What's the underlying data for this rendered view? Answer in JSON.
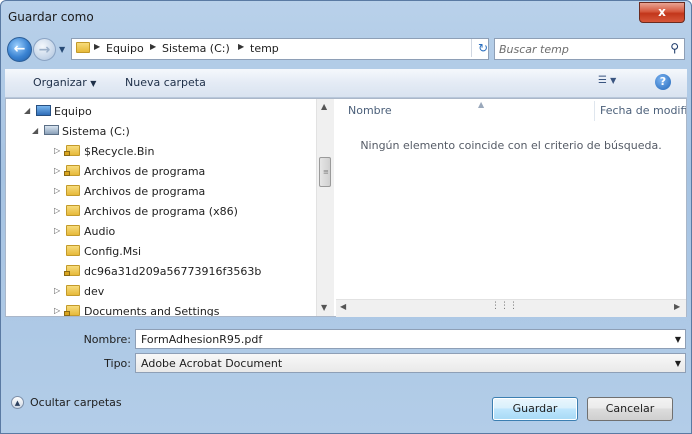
{
  "window": {
    "title": "Guardar como",
    "close_label": "x"
  },
  "address": {
    "crumbs": [
      "Equipo",
      "Sistema (C:)",
      "temp"
    ]
  },
  "search": {
    "placeholder": "Buscar temp"
  },
  "toolbar": {
    "organize_label": "Organizar",
    "new_folder_label": "Nueva carpeta",
    "help_label": "?"
  },
  "tree": [
    {
      "label": "Equipo",
      "icon": "computer-icon",
      "level": 0,
      "expander": "expanded"
    },
    {
      "label": "Sistema (C:)",
      "icon": "drive-icon",
      "level": 1,
      "expander": "expanded"
    },
    {
      "label": "$Recycle.Bin",
      "icon": "locked-folder-icon",
      "level": 2,
      "expander": "collapsed"
    },
    {
      "label": "Archivos de programa",
      "icon": "locked-folder-icon",
      "level": 2,
      "expander": "collapsed"
    },
    {
      "label": "Archivos de programa",
      "icon": "folder-icon",
      "level": 2,
      "expander": "collapsed"
    },
    {
      "label": "Archivos de programa (x86)",
      "icon": "folder-icon",
      "level": 2,
      "expander": "collapsed"
    },
    {
      "label": "Audio",
      "icon": "folder-icon",
      "level": 2,
      "expander": "collapsed"
    },
    {
      "label": "Config.Msi",
      "icon": "folder-icon",
      "level": 2,
      "expander": "none"
    },
    {
      "label": "dc96a31d209a56773916f3563b",
      "icon": "locked-folder-icon",
      "level": 2,
      "expander": "none"
    },
    {
      "label": "dev",
      "icon": "folder-icon",
      "level": 2,
      "expander": "collapsed"
    },
    {
      "label": "Documents and Settings",
      "icon": "locked-folder-icon",
      "level": 2,
      "expander": "collapsed"
    }
  ],
  "filelist": {
    "columns": [
      "Nombre",
      "Fecha de modifica"
    ],
    "empty_message": "Ningún elemento coincide con el criterio de búsqueda."
  },
  "form": {
    "name_label": "Nombre:",
    "name_value": "FormAdhesionR95.pdf",
    "type_label": "Tipo:",
    "type_value": "Adobe Acrobat Document"
  },
  "footer": {
    "hide_folders_label": "Ocultar carpetas",
    "save_label": "Guardar",
    "cancel_label": "Cancelar"
  }
}
